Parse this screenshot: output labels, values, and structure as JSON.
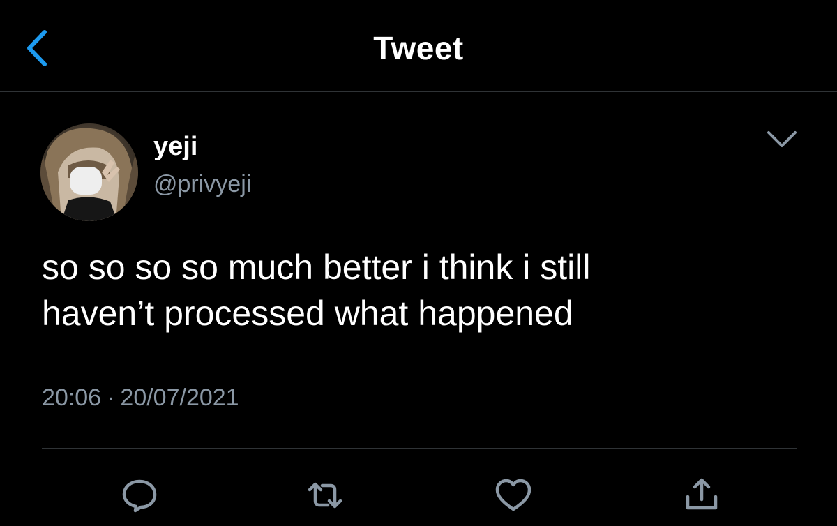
{
  "header": {
    "title": "Tweet",
    "back_icon": "chevron-left-icon"
  },
  "colors": {
    "background": "#000000",
    "accent": "#1d9bf0",
    "text": "#ffffff",
    "secondary_text": "#8b98a5",
    "divider": "#2f3336"
  },
  "tweet": {
    "author": {
      "display_name": "yeji",
      "handle": "@privyeji"
    },
    "text_lines": [
      "so so so so much better i think i still",
      "haven’t processed what happened"
    ],
    "time": "20:06",
    "separator": "·",
    "date": "20/07/2021"
  },
  "actions": [
    {
      "name": "reply",
      "icon": "comment-icon"
    },
    {
      "name": "retweet",
      "icon": "retweet-icon"
    },
    {
      "name": "like",
      "icon": "heart-icon"
    },
    {
      "name": "share",
      "icon": "share-icon"
    }
  ]
}
